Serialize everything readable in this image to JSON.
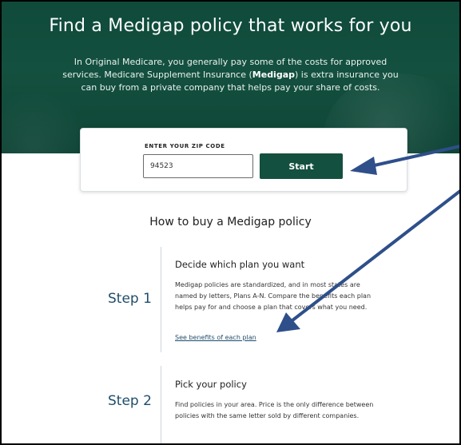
{
  "hero": {
    "title": "Find a Medigap policy that works for you",
    "desc_part1": "In Original Medicare, you generally pay some of the costs for approved services. Medicare Supplement Insurance (",
    "desc_bold": "Medigap",
    "desc_part2": ") is extra insurance you can buy from a private company that helps pay your share of costs."
  },
  "zip": {
    "label": "ENTER YOUR ZIP CODE",
    "value": "94523",
    "start_label": "Start"
  },
  "how": {
    "title": "How to buy a Medigap policy"
  },
  "steps": [
    {
      "label": "Step 1",
      "title": "Decide which plan you want",
      "desc": "Medigap policies are standardized, and in most states are named by letters, Plans A-N. Compare the benefits each plan helps pay for and choose a plan that covers what you need.",
      "link": "See benefits of each plan"
    },
    {
      "label": "Step 2",
      "title": "Pick your policy",
      "desc": "Find policies in your area. Price is the only difference between policies with the same letter sold by different companies."
    }
  ],
  "colors": {
    "hero_green": "#14503f",
    "button_green": "#14503f",
    "step_blue": "#1f4d6b",
    "annotation_arrow": "#2e4f8a"
  }
}
